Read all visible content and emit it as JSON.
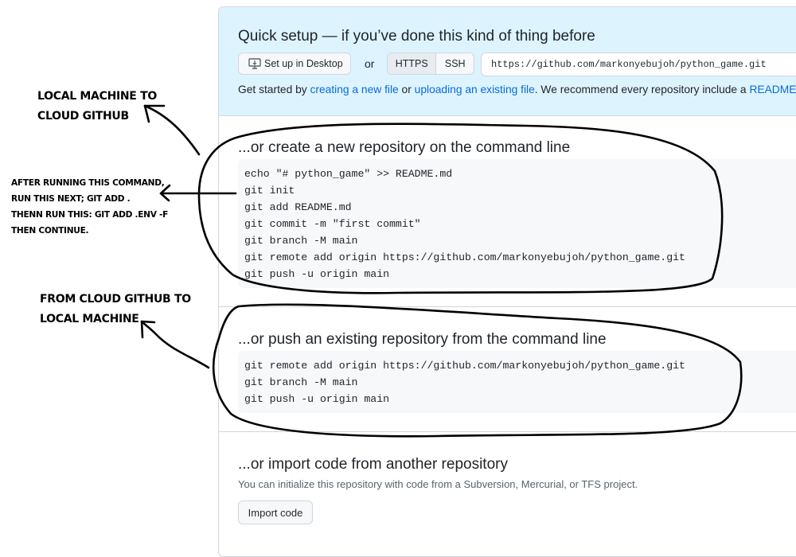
{
  "quick_setup": {
    "title": "Quick setup — if you’ve done this kind of thing before",
    "desktop_button": "Set up in Desktop",
    "or": "or",
    "protocols": [
      "HTTPS",
      "SSH"
    ],
    "selected_protocol": "HTTPS",
    "clone_url": "https://github.com/markonyebujoh/python_game.git",
    "intro": {
      "p1": "Get started by ",
      "link1": "creating a new file",
      "p2": " or ",
      "link2": "uploading an existing file",
      "p3": ". We recommend every repository include a ",
      "link3": "README"
    }
  },
  "create_section": {
    "title": "...or create a new repository on the command line",
    "commands": [
      "echo \"# python_game\" >> README.md",
      "git init",
      "git add README.md",
      "git commit -m \"first commit\"",
      "git branch -M main",
      "git remote add origin https://github.com/markonyebujoh/python_game.git",
      "git push -u origin main"
    ]
  },
  "push_section": {
    "title": "...or push an existing repository from the command line",
    "commands": [
      "git remote add origin https://github.com/markonyebujoh/python_game.git",
      "git branch -M main",
      "git push -u origin main"
    ]
  },
  "import_section": {
    "title": "...or import code from another repository",
    "description": "You can initialize this repository with code from a Subversion, Mercurial, or TFS project.",
    "button": "Import code"
  },
  "annotations": {
    "local_to_cloud": [
      "Local machine to",
      "cloud github"
    ],
    "after_running": [
      "After running this command,",
      "run this next; git add .",
      "Thenn run this: git add .env -f",
      "then continue."
    ],
    "cloud_to_local": [
      "From cloud github to",
      "local machine"
    ]
  },
  "colors": {
    "link": "#0969da",
    "quick_setup_bg": "#ddf4ff",
    "code_bg": "#f6f8fa",
    "border": "#d0d7de"
  }
}
